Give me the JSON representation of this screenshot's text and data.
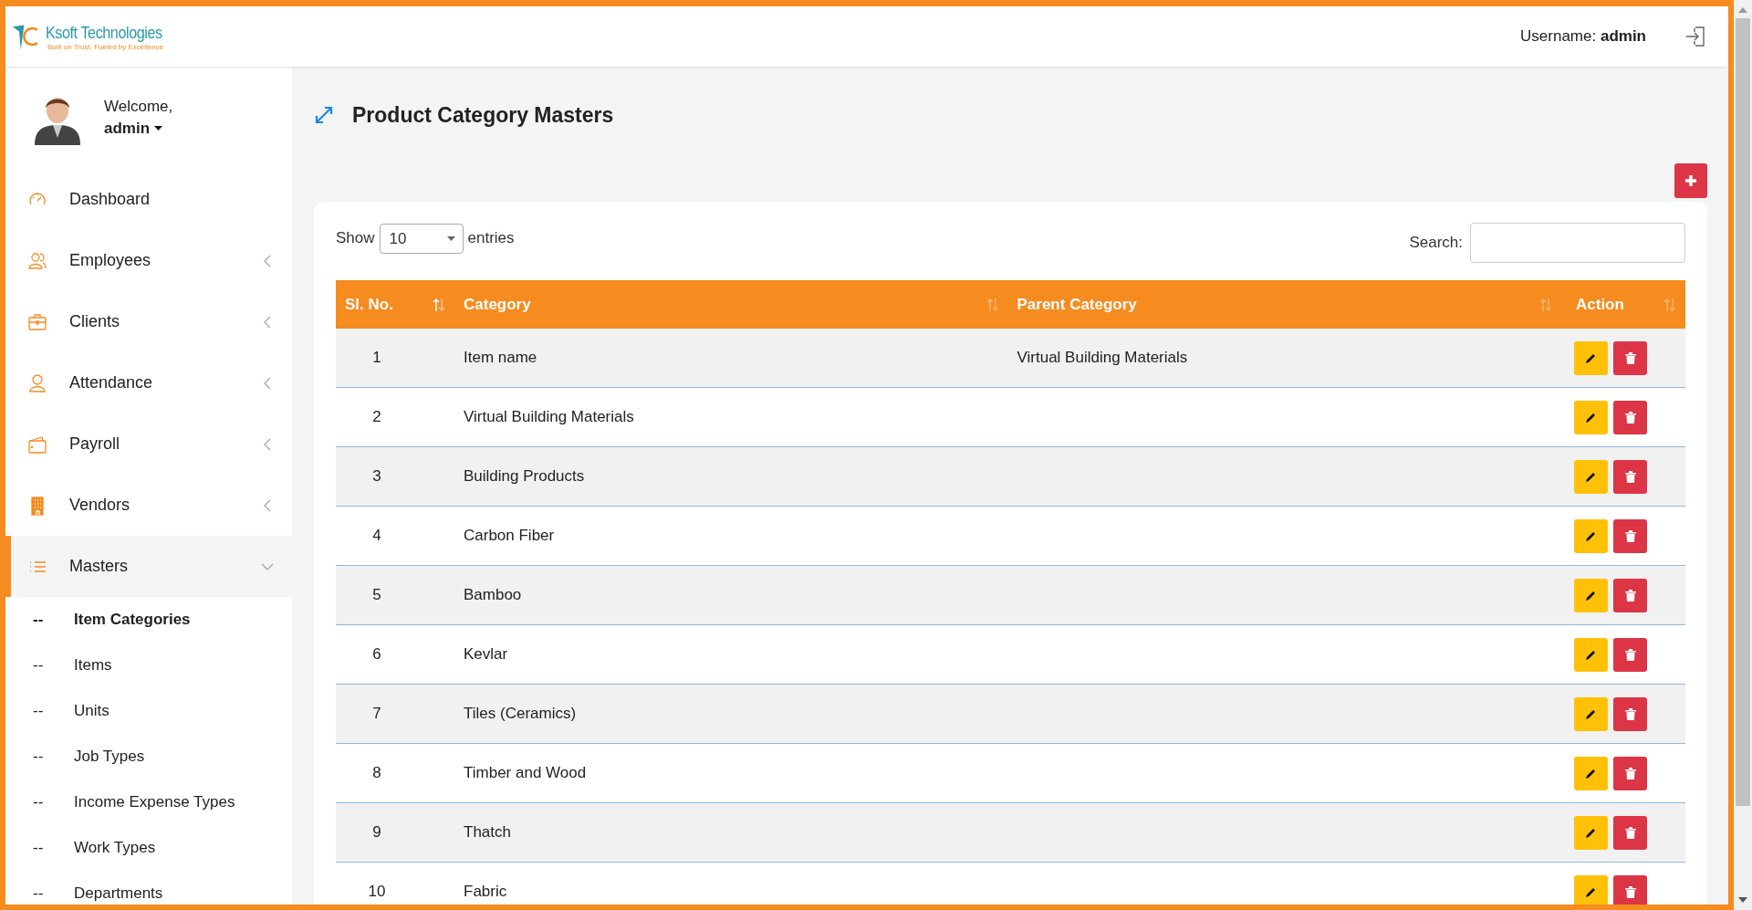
{
  "header": {
    "logo": {
      "name": "Ksoft Technologies",
      "tagline": "Built on Trust, Fueled by Excellence"
    },
    "username_label": "Username:",
    "username": "admin"
  },
  "sidebar": {
    "welcome": "Welcome,",
    "user": "admin",
    "items": [
      {
        "label": "Dashboard",
        "selected": false
      },
      {
        "label": "Employees",
        "expanded": false,
        "selected": false
      },
      {
        "label": "Clients",
        "expanded": false,
        "selected": false
      },
      {
        "label": "Attendance",
        "expanded": false,
        "selected": false
      },
      {
        "label": "Payroll",
        "expanded": false,
        "selected": false
      },
      {
        "label": "Vendors",
        "expanded": false,
        "selected": false
      },
      {
        "label": "Masters",
        "expanded": true,
        "selected": true,
        "children": [
          {
            "marker": "--",
            "label": "Item Categories",
            "selected": true
          },
          {
            "marker": "--",
            "label": "Items",
            "selected": false
          },
          {
            "marker": "--",
            "label": "Units",
            "selected": false
          },
          {
            "marker": "--",
            "label": "Job Types",
            "selected": false
          },
          {
            "marker": "--",
            "label": "Income Expense Types",
            "selected": false
          },
          {
            "marker": "--",
            "label": "Work Types",
            "selected": false
          },
          {
            "marker": "--",
            "label": "Departments",
            "selected": false
          }
        ]
      }
    ]
  },
  "page": {
    "title": "Product Category Masters"
  },
  "table": {
    "show_label": "Show",
    "page_size": "10",
    "entries_label": "entries",
    "search_label": "Search:",
    "columns": [
      {
        "label": "Sl. No.",
        "sorted": true
      },
      {
        "label": "Category",
        "sorted": false
      },
      {
        "label": "Parent Category",
        "sorted": false
      },
      {
        "label": "Action",
        "sorted": false
      }
    ],
    "rows": [
      {
        "number": "1",
        "category": "Item name",
        "parent_category": "Virtual Building Materials"
      },
      {
        "number": "2",
        "category": "Virtual Building Materials"
      },
      {
        "number": "3",
        "category": "Building Products"
      },
      {
        "number": "4",
        "category": "Carbon Fiber"
      },
      {
        "number": "5",
        "category": "Bamboo"
      },
      {
        "number": "6",
        "category": "Kevlar"
      },
      {
        "number": "7",
        "category": "Tiles (Ceramics)"
      },
      {
        "number": "8",
        "category": "Timber and Wood"
      },
      {
        "number": "9",
        "category": "Thatch"
      },
      {
        "number": "10",
        "category": "Fabric"
      }
    ]
  }
}
